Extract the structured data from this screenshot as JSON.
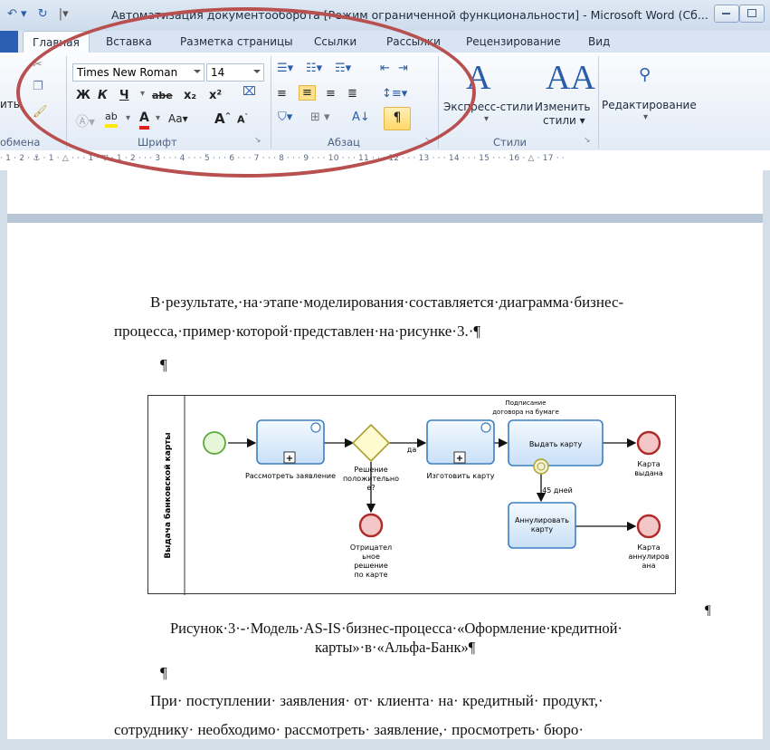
{
  "window": {
    "title": "Автоматизация документооборота [Режим ограниченной функциональности]  -  Microsoft Word (Сб..."
  },
  "ribbon": {
    "tabs": [
      "Главная",
      "Вставка",
      "Разметка страницы",
      "Ссылки",
      "Рассылки",
      "Рецензирование",
      "Вид"
    ],
    "active_tab": "Главная",
    "clipboard_group_label": "обмена",
    "clipboard_paste_partial": "ить",
    "font_group_label": "Шрифт",
    "paragraph_group_label": "Абзац",
    "styles_group_label": "Стили",
    "font_name": "Times New Roman",
    "font_size": "14",
    "bold": "Ж",
    "italic": "К",
    "underline": "Ч",
    "strike": "abe",
    "subscript": "x₂",
    "superscript": "x²",
    "change_case": "Aa",
    "grow_font": "A",
    "shrink_font": "A",
    "show_marks": "¶",
    "express_styles": "Экспресс-стили",
    "change_styles_1": "Изменить",
    "change_styles_2": "стили",
    "editing": "Редактирование"
  },
  "ruler": {
    "text": "· 1 · 2 · ⚓ · 1 · △ · · · 1 · ▽ · 1 · 2 · · · 3 · · · 4 · · · 5 · · · 6 · · · 7 · · · 8 · · · 9 · · · 10 · · · 11 · · · 12 · · · 13 · · · 14 · · · 15 · · · 16 · △ · 17 · ·"
  },
  "document": {
    "para1_line1": "В·результате,·на·этапе·моделирования·составляется·диаграмма·бизнес-",
    "para1_line2": "процесса,·пример·которой·представлен·на·рисунке·3.·¶",
    "empty_mark": "¶",
    "right_mark": "¶",
    "caption_line1": "Рисунок·3·-·Модель·AS-IS·бизнес-процесса·«Оформление·кредитной·",
    "caption_line2": "карты»·в·«Альфа-Банк»¶",
    "empty_mark2": "¶",
    "para2_line1": "При·  поступлении·  заявления·  от·  клиента·  на·  кредитный·  продукт,·",
    "para2_line2": "сотруднику·  необходимо·  рассмотреть·  заявление,·  просмотреть·  бюро·"
  },
  "diagram": {
    "pool_label": "Выдача банковской карты",
    "task_review": "Рассмотреть заявление",
    "gateway_label_1": "Решение",
    "gateway_label_2": "положительно",
    "gateway_label_3": "е?",
    "yes_label": "да",
    "task_make": "Изготовить карту",
    "signing_label_1": "Подписание",
    "signing_label_2": "договора на бумаге",
    "task_issue": "Выдать карту",
    "end_issued_1": "Карта",
    "end_issued_2": "выдана",
    "timer_label": "45 дней",
    "task_cancel_1": "Аннулировать",
    "task_cancel_2": "карту",
    "end_cancelled_1": "Карта",
    "end_cancelled_2": "аннулиров",
    "end_cancelled_3": "ана",
    "end_negative_1": "Отрицател",
    "end_negative_2": "ьное",
    "end_negative_3": "решение",
    "end_negative_4": "по карте"
  },
  "colors": {
    "annotation_ellipse": "#b85050",
    "task_fill": "#d6e9fb",
    "task_stroke": "#3d7fc0",
    "start_fill": "#e6f6d8",
    "start_stroke": "#5da83a",
    "end_fill": "#f3c7c7",
    "end_stroke": "#b02a2a",
    "gateway_fill": "#fffbd0",
    "gateway_stroke": "#a9a030"
  }
}
